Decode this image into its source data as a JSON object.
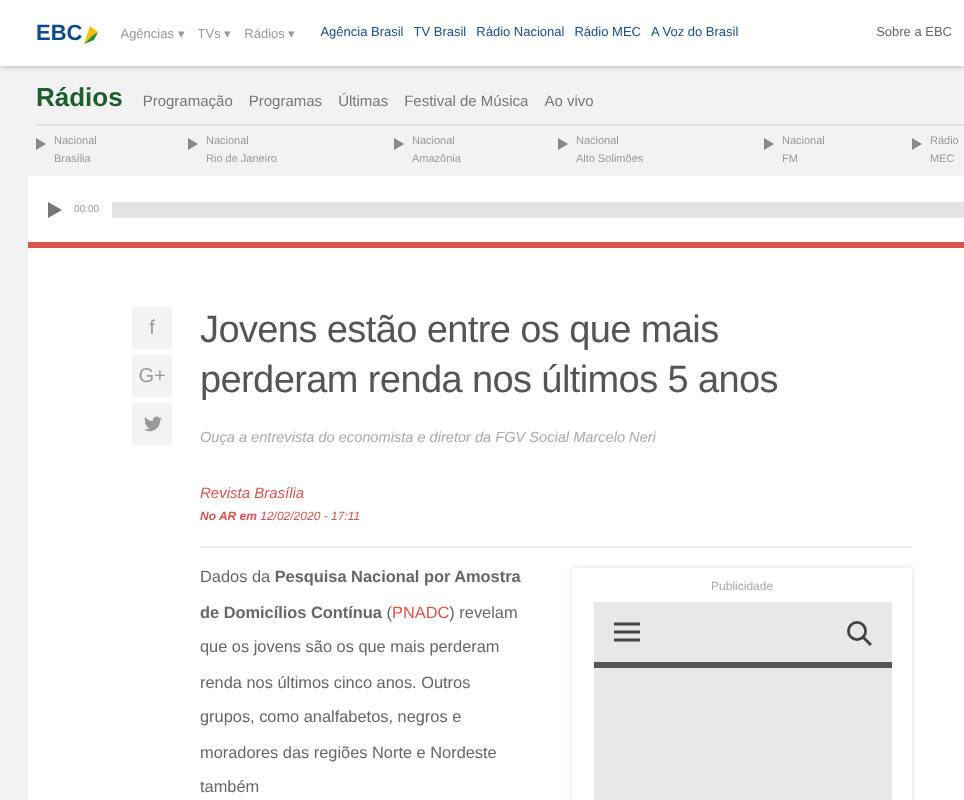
{
  "header": {
    "logo": "EBC",
    "menus": [
      "Agências ▾",
      "TVs ▾",
      "Rádios ▾"
    ],
    "links": [
      "Agência Brasil",
      "TV Brasil",
      "Rádio Nacional",
      "Rádio MEC",
      "A Voz do Brasil"
    ],
    "about": "Sobre a EBC"
  },
  "section": {
    "title": "Rádios",
    "nav": [
      "Programação",
      "Programas",
      "Últimas",
      "Festival de Música",
      "Ao vivo"
    ],
    "stations": [
      {
        "line1": "Nacional",
        "line2": "Brasília"
      },
      {
        "line1": "Nacional",
        "line2": "Rio de Janeiro"
      },
      {
        "line1": "Nacional",
        "line2": "Amazônia"
      },
      {
        "line1": "Nacional",
        "line2": "Alto Solimões"
      },
      {
        "line1": "Nacional",
        "line2": "FM"
      },
      {
        "line1": "Rádio",
        "line2": "MEC"
      }
    ]
  },
  "player": {
    "time": "00:00"
  },
  "share": [
    "f",
    "G+"
  ],
  "article": {
    "title": "Jovens estão entre os que mais perderam renda nos últimos 5 anos",
    "subtitle": "Ouça a entrevista do economista e diretor da FGV Social Marcelo Neri",
    "program": "Revista Brasília",
    "aired_label": "No AR em",
    "aired_date": "12/02/2020 - 17:11",
    "body_before": "Dados da **Pesquisa Nacional por Amostra de Domicílios Contínua** (",
    "body_link": "PNADC",
    "body_after": ") revelam que os jovens são os que mais perderam renda nos últimos cinco anos. Outros grupos, como analfabetos, negros e moradores das regiões Norte e Nordeste também"
  },
  "ad": {
    "label": "Publicidade"
  }
}
